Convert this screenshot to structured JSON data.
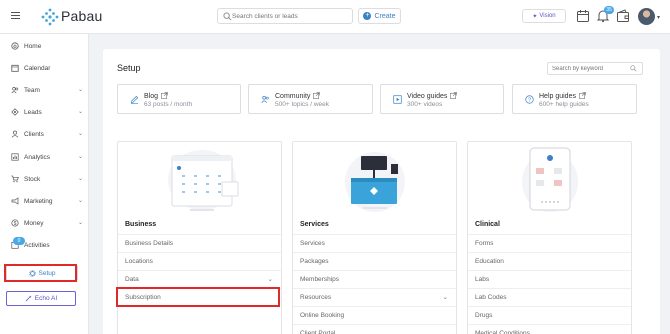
{
  "brand": {
    "name": "Pabau"
  },
  "header": {
    "search_placeholder": "Search clients or leads",
    "create_label": "Create",
    "vision_label": "Vision",
    "notification_count": "35"
  },
  "sidebar": {
    "items": [
      {
        "label": "Home",
        "icon": "home-icon"
      },
      {
        "label": "Calendar",
        "icon": "calendar-icon"
      },
      {
        "label": "Team",
        "icon": "team-icon",
        "expandable": true
      },
      {
        "label": "Leads",
        "icon": "leads-icon",
        "expandable": true
      },
      {
        "label": "Clients",
        "icon": "clients-icon",
        "expandable": true
      },
      {
        "label": "Analytics",
        "icon": "analytics-icon",
        "expandable": true
      },
      {
        "label": "Stock",
        "icon": "cart-icon",
        "expandable": true
      },
      {
        "label": "Marketing",
        "icon": "marketing-icon",
        "expandable": true
      },
      {
        "label": "Money",
        "icon": "money-icon",
        "expandable": true
      },
      {
        "label": "Activities",
        "icon": "activities-icon",
        "badge": "0"
      }
    ],
    "setup_label": "Setup",
    "echo_label": "Echo AI"
  },
  "main": {
    "title": "Setup",
    "search_placeholder": "Search by keyword",
    "resources": [
      {
        "title": "Blog",
        "subtitle": "63 posts / month",
        "icon": "pencil-icon"
      },
      {
        "title": "Community",
        "subtitle": "500+ topics / week",
        "icon": "community-icon"
      },
      {
        "title": "Video guides",
        "subtitle": "300+ videos",
        "icon": "video-icon"
      },
      {
        "title": "Help guides",
        "subtitle": "600+ help guides",
        "icon": "help-icon"
      }
    ],
    "columns": [
      {
        "heading": "Business",
        "rows": [
          "Business Details",
          "Locations",
          "Data",
          "Subscription"
        ]
      },
      {
        "heading": "Services",
        "rows": [
          "Services",
          "Packages",
          "Memberships",
          "Resources",
          "Online Booking",
          "Client Portal"
        ]
      },
      {
        "heading": "Clinical",
        "rows": [
          "Forms",
          "Education",
          "Labs",
          "Lab Codes",
          "Drugs",
          "Medical Conditions"
        ]
      }
    ]
  },
  "colors": {
    "accent": "#3b82c4",
    "highlight": "#e02a2a",
    "badge": "#48a9e6",
    "ai": "#5a55c9"
  }
}
